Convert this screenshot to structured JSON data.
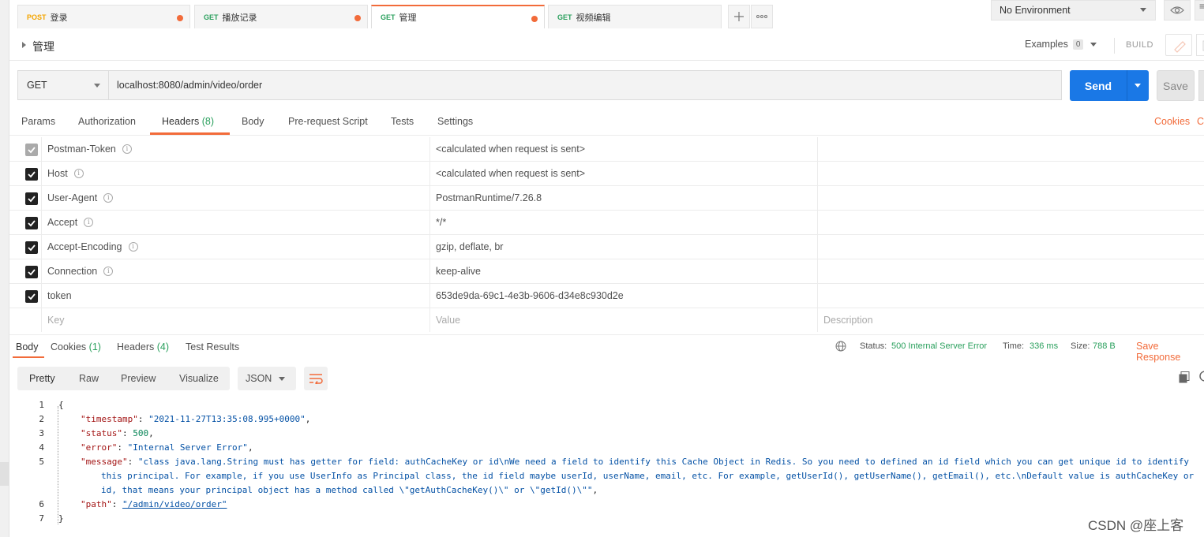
{
  "tabs": [
    {
      "method": "POST",
      "title": "登录"
    },
    {
      "method": "GET",
      "title": "播放记录"
    },
    {
      "method": "GET",
      "title": "管理"
    },
    {
      "method": "GET",
      "title": "视频编辑"
    }
  ],
  "environment": {
    "selected": "No Environment"
  },
  "request": {
    "name": "管理",
    "examples_label": "Examples",
    "examples_count": "0",
    "build_label": "BUILD",
    "method": "GET",
    "url": "localhost:8080/admin/video/order",
    "send_label": "Send",
    "save_label": "Save"
  },
  "subtabs": {
    "params": "Params",
    "authorization": "Authorization",
    "headers": "Headers",
    "headers_count": "(8)",
    "body": "Body",
    "prerequest": "Pre-request Script",
    "tests": "Tests",
    "settings": "Settings",
    "cookies": "Cookies",
    "cookies_cut": "C"
  },
  "headers": {
    "rows": [
      {
        "key": "Postman-Token",
        "value": "<calculated when request is sent>"
      },
      {
        "key": "Host",
        "value": "<calculated when request is sent>"
      },
      {
        "key": "User-Agent",
        "value": "PostmanRuntime/7.26.8"
      },
      {
        "key": "Accept",
        "value": "*/*"
      },
      {
        "key": "Accept-Encoding",
        "value": "gzip, deflate, br"
      },
      {
        "key": "Connection",
        "value": "keep-alive"
      },
      {
        "key": "token",
        "value": "653de9da-69c1-4e3b-9606-d34e8c930d2e"
      }
    ],
    "placeholder": {
      "key": "Key",
      "value": "Value",
      "description": "Description"
    }
  },
  "response": {
    "tabs": {
      "body": "Body",
      "cookies": "Cookies",
      "cookies_count": "(1)",
      "headers": "Headers",
      "headers_count": "(4)",
      "test_results": "Test Results"
    },
    "status_label": "Status:",
    "status_value": "500 Internal Server Error",
    "time_label": "Time:",
    "time_value": "336 ms",
    "size_label": "Size:",
    "size_value": "788 B",
    "save_response": "Save Response",
    "view_tabs": {
      "pretty": "Pretty",
      "raw": "Raw",
      "preview": "Preview",
      "visualize": "Visualize"
    },
    "format": "JSON",
    "body": {
      "ln1": "1",
      "ln2": "2",
      "ln3": "3",
      "ln4": "4",
      "ln5": "5",
      "ln6": "6",
      "ln7": "7",
      "open": "{",
      "close": "}",
      "k_timestamp": "\"timestamp\"",
      "v_timestamp": "\"2021-11-27T13:35:08.995+0000\"",
      "k_status": "\"status\"",
      "v_status": "500",
      "k_error": "\"error\"",
      "v_error": "\"Internal Server Error\"",
      "k_message": "\"message\"",
      "v_message_1": "\"class java.lang.String must has getter for field: authCacheKey or id\\nWe need a field to identify this Cache Object in Redis. So you need to defined an id field which you can get unique id to identify",
      "v_message_2": "this principal. For example, if you use UserInfo as Principal class, the id field maybe userId, userName, email, etc. For example, getUserId(), getUserName(), getEmail(), etc.\\nDefault value is authCacheKey or",
      "v_message_3": "id, that means your principal object has a method called \\\"getAuthCacheKey()\\\" or \\\"getId()\\\"\"",
      "k_path": "\"path\"",
      "v_path": "\"/admin/video/order\""
    }
  },
  "watermark": "CSDN @座上客",
  "colors": {
    "accent": "#f26b3a",
    "send": "#1a78e6",
    "get": "#2aa05d",
    "post": "#f4a500"
  }
}
